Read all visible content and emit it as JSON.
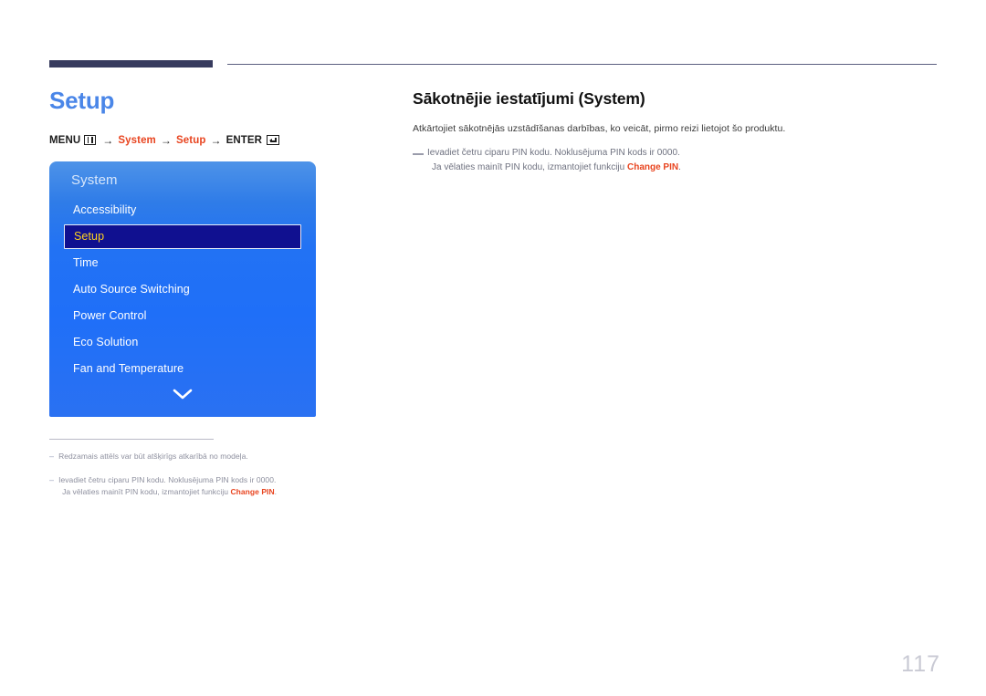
{
  "header": {
    "rule_color_thick": "#373b5e",
    "rule_color_thin": "#5b5f7f"
  },
  "left": {
    "page_title": "Setup",
    "breadcrumb": {
      "menu_label": "MENU",
      "menu_icon": "menu-grid-icon",
      "arrow": "→",
      "step1": "System",
      "step2": "Setup",
      "enter_label": "ENTER",
      "enter_icon": "enter-key-icon",
      "accent_color": "#e8441f"
    },
    "osd": {
      "heading": "System",
      "items": [
        {
          "label": "Accessibility",
          "selected": false
        },
        {
          "label": "Setup",
          "selected": true
        },
        {
          "label": "Time",
          "selected": false
        },
        {
          "label": "Auto Source Switching",
          "selected": false
        },
        {
          "label": "Power Control",
          "selected": false
        },
        {
          "label": "Eco Solution",
          "selected": false
        },
        {
          "label": "Fan and Temperature",
          "selected": false
        }
      ],
      "scroll_indicator": "chevron-down-icon",
      "selected_text_color": "#ffd21e",
      "selected_bg_color": "#101090"
    },
    "footnotes": [
      {
        "dash": "–",
        "line1": "Redzamais attēls var būt atšķirīgs atkarībā no modeļa.",
        "line2": "",
        "line2_prefix": "",
        "line2_accent": "",
        "line2_suffix": ""
      },
      {
        "dash": "–",
        "line1": "Ievadiet četru ciparu PIN kodu. Noklusējuma PIN kods ir 0000.",
        "line2": "",
        "line2_prefix": "Ja vēlaties mainīt PIN kodu, izmantojiet funkciju ",
        "line2_accent": "Change PIN",
        "line2_suffix": "."
      }
    ]
  },
  "right": {
    "section_title": "Sākotnējie iestatījumi (System)",
    "intro": "Atkārtojiet sākotnējās uzstādīšanas darbības, ko veicāt, pirmo reizi lietojot šo produktu.",
    "note": {
      "line1": "Ievadiet četru ciparu PIN kodu. Noklusējuma PIN kods ir 0000.",
      "line2_prefix": "Ja vēlaties mainīt PIN kodu, izmantojiet funkciju ",
      "line2_accent": "Change PIN",
      "line2_suffix": "."
    }
  },
  "footer": {
    "page_number": "117"
  }
}
